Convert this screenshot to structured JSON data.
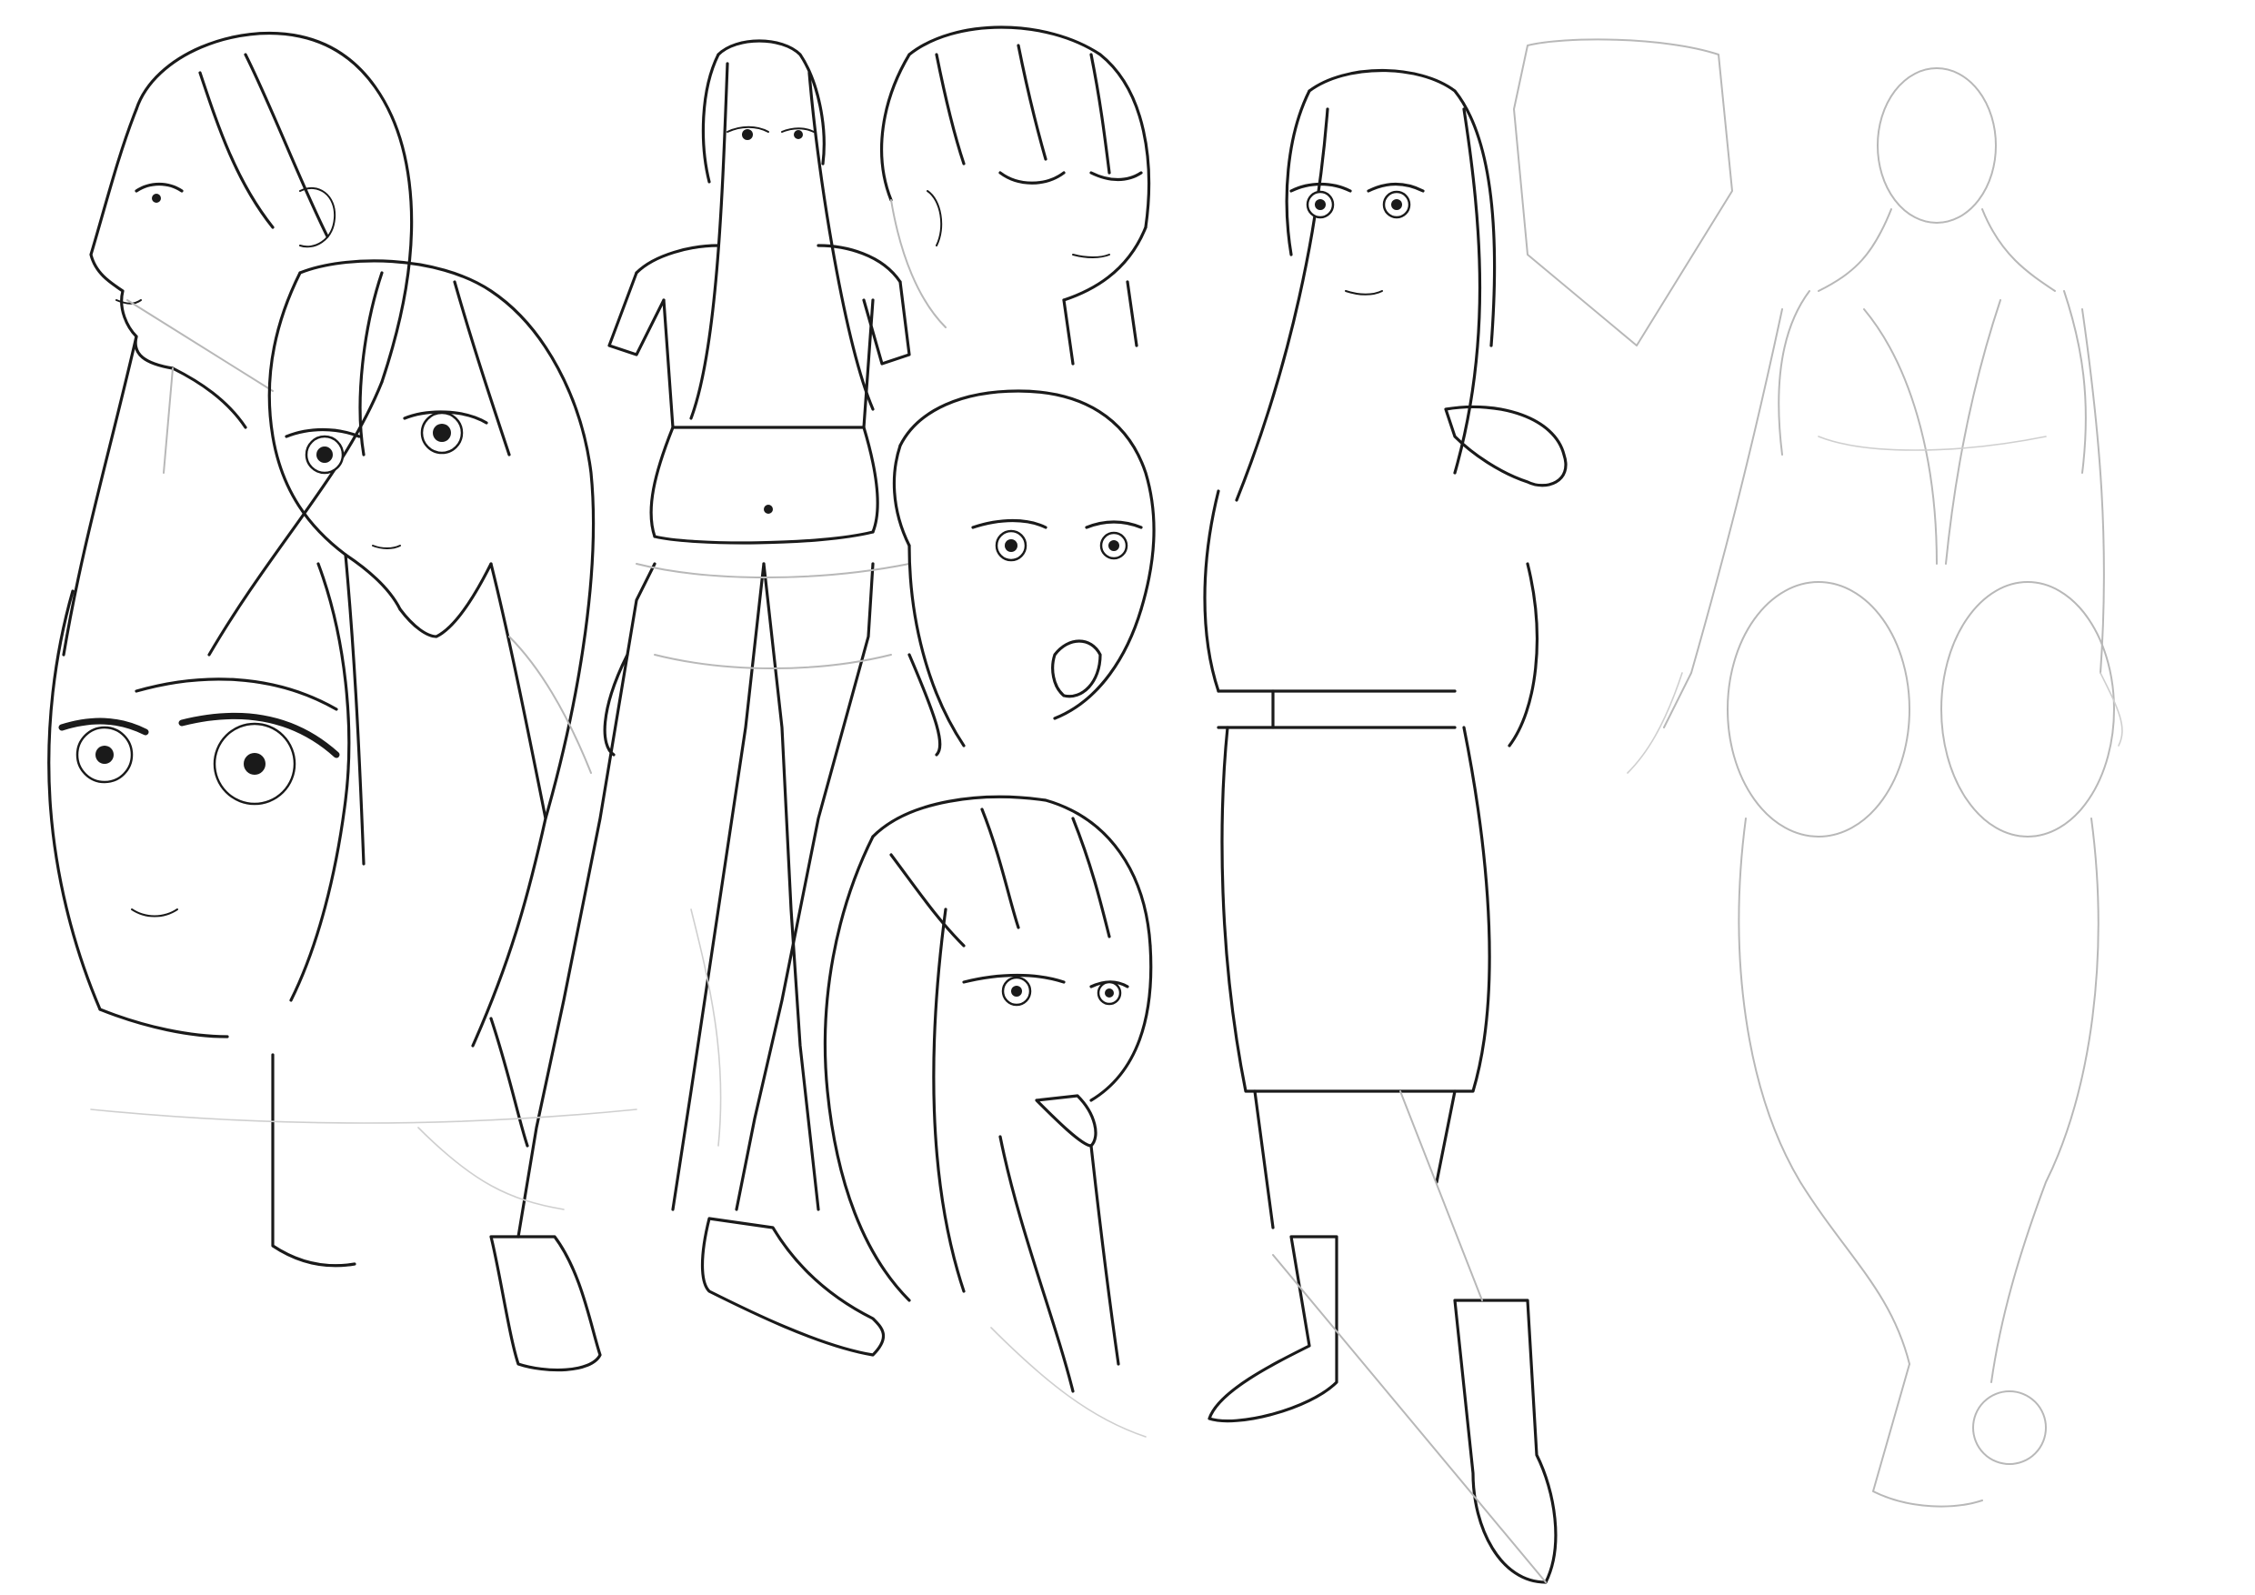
{
  "artwork": {
    "style": "character-sheet line art",
    "palette": {
      "background": "#ffffff",
      "ink": "#1a1a1a",
      "sketch": "#b8b8b8",
      "sketch_light": "#cfcfcf"
    },
    "figures": [
      {
        "id": "profile-head",
        "icon": "head-profile"
      },
      {
        "id": "three-quarter-head",
        "icon": "head-three-quarter"
      },
      {
        "id": "close-up-face",
        "icon": "head-close-up"
      },
      {
        "id": "standing-figure-crop-top",
        "icon": "figure-standing"
      },
      {
        "id": "eyes-closed-head",
        "icon": "head-eyes-closed"
      },
      {
        "id": "shouting-head",
        "icon": "head-shouting"
      },
      {
        "id": "tongue-out-head",
        "icon": "head-tongue-out"
      },
      {
        "id": "uniform-figure",
        "icon": "figure-uniform"
      },
      {
        "id": "construction-sketch-back-view",
        "icon": "figure-sketch"
      }
    ]
  }
}
